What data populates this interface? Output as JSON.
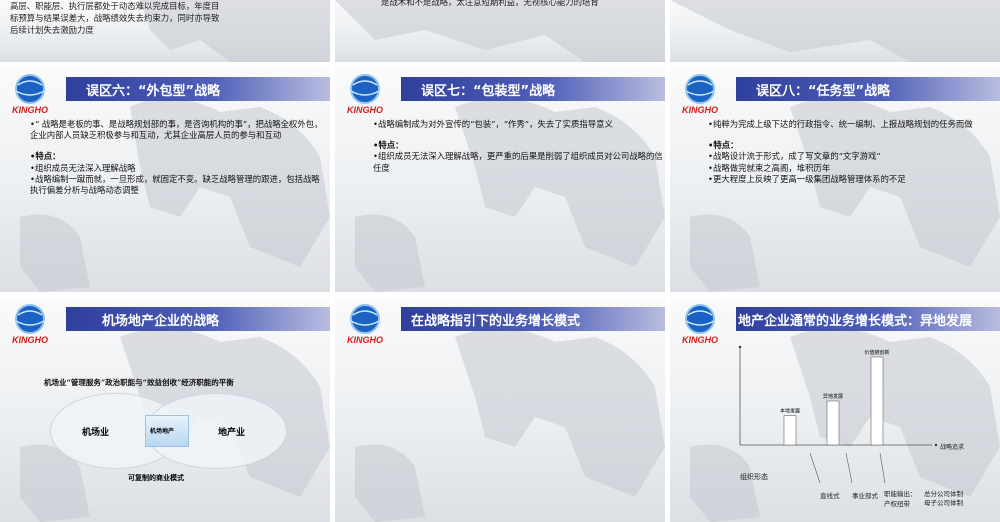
{
  "colors": {
    "title_bar_start": "#2f3f9c",
    "title_bar_end": "#b9bde0",
    "logo_blue": "#1b62c2",
    "logo_red": "#d0201b"
  },
  "logo": {
    "text": "KINGHO"
  },
  "top_row": {
    "left_text": [
      "高层、职能层、执行层都处于动态难以完成目标，年度目",
      "标预算与结果误差大，战略绩效失去约束力，同时亦导致",
      "后续计划失去激励力度"
    ],
    "middle_text": "是战术和不是战略，太注意短期利益，无视核心能力的培育"
  },
  "slide_outsource": {
    "title": "误区六：“外包型”战略",
    "para1": "•“ 战略是老板的事、是战略规划部的事，是咨询机构的事”，把战略全权外包，企业内部人员缺乏积极参与和互动，尤其企业高层人员的参与和互动",
    "features_label": "•特点：",
    "items": [
      "•组织成员无法深入理解战略",
      "•战略编制一蹴而就，一旦形成，就固定不变。缺乏战略管理的跟进，包括战略执行偏差分析与战略动态调整"
    ]
  },
  "slide_packaging": {
    "title": "误区七：“包装型”战略",
    "para1": "•战略编制成为对外宣传的“包装”，“作秀”，失去了实质指导意义",
    "features_label": "•特点：",
    "items": [
      "•组织成员无法深入理解战略，更严重的后果是削弱了组织成员对公司战略的信任度"
    ]
  },
  "slide_task": {
    "title": "误区八：“任务型”战略",
    "para1": "•纯粹为完成上级下达的行政指令、统一编制、上报战略规划的任务而做",
    "features_label": "•特点：",
    "items": [
      "•战略设计流于形式，成了写文章的“文字游戏”",
      "•战略做完就束之高阁，堆积历年",
      "•更大程度上反映了更高一级集团战略管理体系的不足"
    ]
  },
  "slide_airport": {
    "title": "机场地产企业的战略",
    "subtitle": "机场业“管理服务”政治职能与“效益创收”经济职能的平衡",
    "left_circle": "机场业",
    "center": "机场地产",
    "right_circle": "地产业",
    "footer": "可复制的商业模式"
  },
  "slide_growth": {
    "title": "在战略指引下的业务增长模式"
  },
  "slide_mode": {
    "title": "地产企业通常的业务增长模式：异地发展",
    "chart_data": {
      "type": "bar",
      "categories": [
        "本地发展",
        "异地发展",
        "价值链创新"
      ],
      "values": [
        1,
        1.5,
        3
      ],
      "xlabel": "组织形态",
      "ylabel": "战略追求",
      "bottom_labels": [
        "直线式",
        "事业部式",
        "职能输出：产权纽带",
        "总分公司体制",
        "母子公司体制"
      ]
    }
  }
}
